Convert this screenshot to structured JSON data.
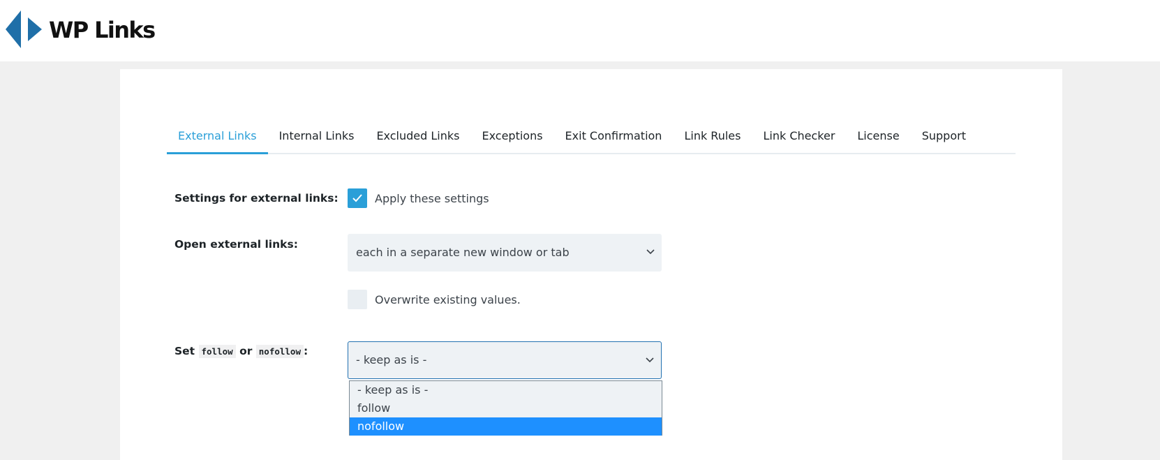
{
  "app": {
    "logo_text": "WP Links"
  },
  "tabs": [
    {
      "label": "External Links",
      "active": true
    },
    {
      "label": "Internal Links",
      "active": false
    },
    {
      "label": "Excluded Links",
      "active": false
    },
    {
      "label": "Exceptions",
      "active": false
    },
    {
      "label": "Exit Confirmation",
      "active": false
    },
    {
      "label": "Link Rules",
      "active": false
    },
    {
      "label": "Link Checker",
      "active": false
    },
    {
      "label": "License",
      "active": false
    },
    {
      "label": "Support",
      "active": false
    }
  ],
  "settings": {
    "apply": {
      "label": "Settings for external links:",
      "checkbox_label": "Apply these settings",
      "checked": true
    },
    "open_links": {
      "label": "Open external links:",
      "value": "each in a separate new window or tab",
      "overwrite_label": "Overwrite existing values.",
      "overwrite_checked": false
    },
    "follow": {
      "label_prefix": "Set",
      "code_follow": "follow",
      "label_or": "or",
      "code_nofollow": "nofollow",
      "label_suffix": ":",
      "value": "- keep as is -",
      "options": [
        "- keep as is -",
        "follow",
        "nofollow"
      ],
      "highlighted_option": "nofollow"
    }
  },
  "colors": {
    "accent": "#2a9fd8",
    "logo_blue": "#1f6fa8",
    "highlight": "#1e90ff"
  },
  "icons": {
    "check": "check-icon",
    "chevron": "chevron-down-icon"
  }
}
